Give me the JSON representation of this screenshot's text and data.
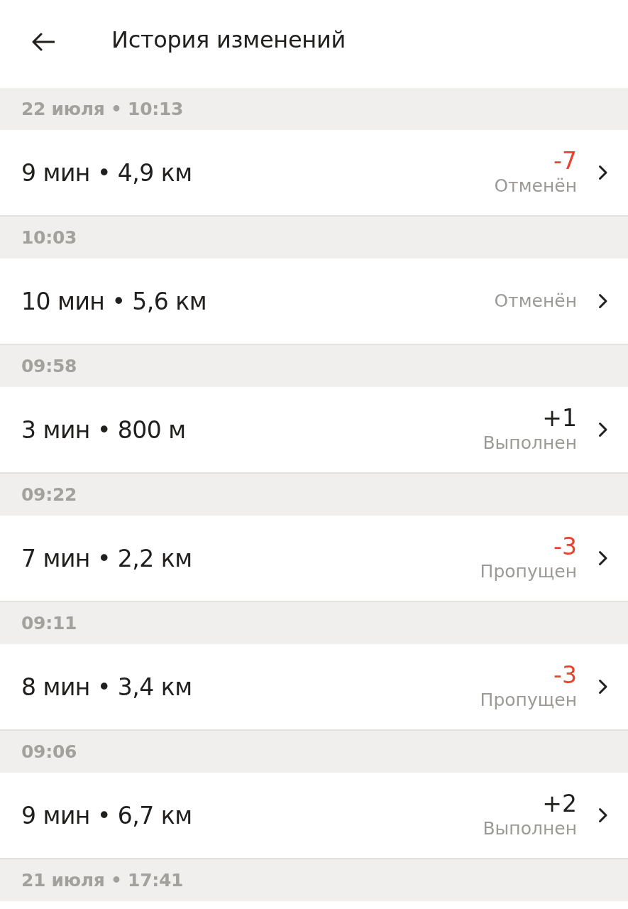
{
  "header": {
    "title": "История изменений"
  },
  "groups": [
    {
      "heading": "22 июля • 10:13",
      "order": {
        "summary": "9 мин • 4,9 км",
        "points": {
          "text": "-7",
          "color": "#e8432f"
        },
        "status": "Отменён"
      }
    },
    {
      "heading": "10:03",
      "order": {
        "summary": "10 мин • 5,6 км",
        "status": "Отменён"
      }
    },
    {
      "heading": "09:58",
      "order": {
        "summary": "3 мин • 800 м",
        "points": {
          "text": "+1",
          "color": "#21201f"
        },
        "status": "Выполнен"
      }
    },
    {
      "heading": "09:22",
      "order": {
        "summary": "7 мин • 2,2 км",
        "points": {
          "text": "-3",
          "color": "#e8432f"
        },
        "status": "Пропущен"
      }
    },
    {
      "heading": "09:11",
      "order": {
        "summary": "8 мин • 3,4 км",
        "points": {
          "text": "-3",
          "color": "#e8432f"
        },
        "status": "Пропущен"
      }
    },
    {
      "heading": "09:06",
      "order": {
        "summary": "9 мин • 6,7 км",
        "points": {
          "text": "+2",
          "color": "#21201f"
        },
        "status": "Выполнен"
      }
    },
    {
      "heading": "21 июля • 17:41"
    }
  ]
}
